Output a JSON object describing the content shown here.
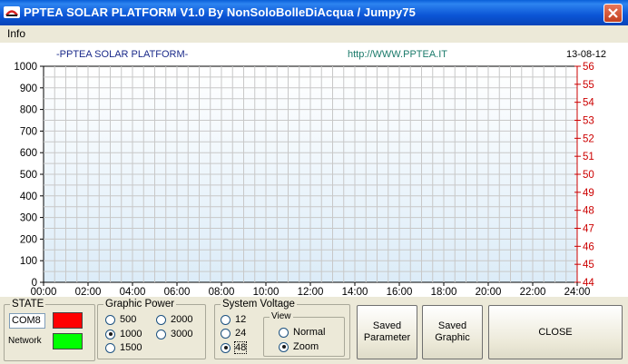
{
  "window": {
    "title": "PPTEA SOLAR PLATFORM V1.0 By NonSoloBolleDiAcqua / Jumpy75"
  },
  "menu": {
    "items": [
      "Info"
    ]
  },
  "chart_header": {
    "left": "-PPTEA SOLAR PLATFORM-",
    "center": "http://WWW.PPTEA.IT",
    "date": "13-08-12"
  },
  "chart_data": {
    "type": "line",
    "x_ticks": [
      "00:00",
      "02:00",
      "04:00",
      "06:00",
      "08:00",
      "10:00",
      "12:00",
      "14:00",
      "16:00",
      "18:00",
      "20:00",
      "22:00",
      "24:00"
    ],
    "y_left_ticks": [
      "1000",
      "900",
      "800",
      "700",
      "600",
      "500",
      "400",
      "300",
      "200",
      "100",
      "0"
    ],
    "y_right_ticks": [
      "56",
      "55",
      "54",
      "53",
      "52",
      "51",
      "50",
      "49",
      "48",
      "47",
      "46",
      "45",
      "44"
    ],
    "ylim_left": [
      0,
      1000
    ],
    "ylim_right": [
      44,
      56
    ],
    "grid": true,
    "series": [],
    "colors": {
      "left_axis": "#000000",
      "right_axis": "#cc0000",
      "grid": "#c8c8c8",
      "plot_bg_top": "#ffffff",
      "plot_bg_bottom": "#dcecf8",
      "header_center": "#1a7a6a",
      "header_left": "#1a2a8a"
    }
  },
  "state": {
    "title": "STATE",
    "port_value": "COM8",
    "network_label": "Network",
    "port_led_color": "#ff0000",
    "network_led_color": "#00ff00"
  },
  "graphic_power": {
    "title": "Graphic Power",
    "options": [
      {
        "label": "500",
        "selected": false
      },
      {
        "label": "2000",
        "selected": false
      },
      {
        "label": "1000",
        "selected": true
      },
      {
        "label": "3000",
        "selected": false
      },
      {
        "label": "1500",
        "selected": false
      }
    ]
  },
  "system_voltage": {
    "title": "System Voltage",
    "options": [
      {
        "label": "12",
        "selected": false
      },
      {
        "label": "24",
        "selected": false
      },
      {
        "label": "48",
        "selected": true
      }
    ],
    "view": {
      "title": "View",
      "options": [
        {
          "label": "Normal",
          "selected": false
        },
        {
          "label": "Zoom",
          "selected": true
        }
      ]
    }
  },
  "buttons": {
    "saved_parameter": "Saved\nParameter",
    "saved_graphic": "Saved\nGraphic",
    "close": "CLOSE"
  }
}
